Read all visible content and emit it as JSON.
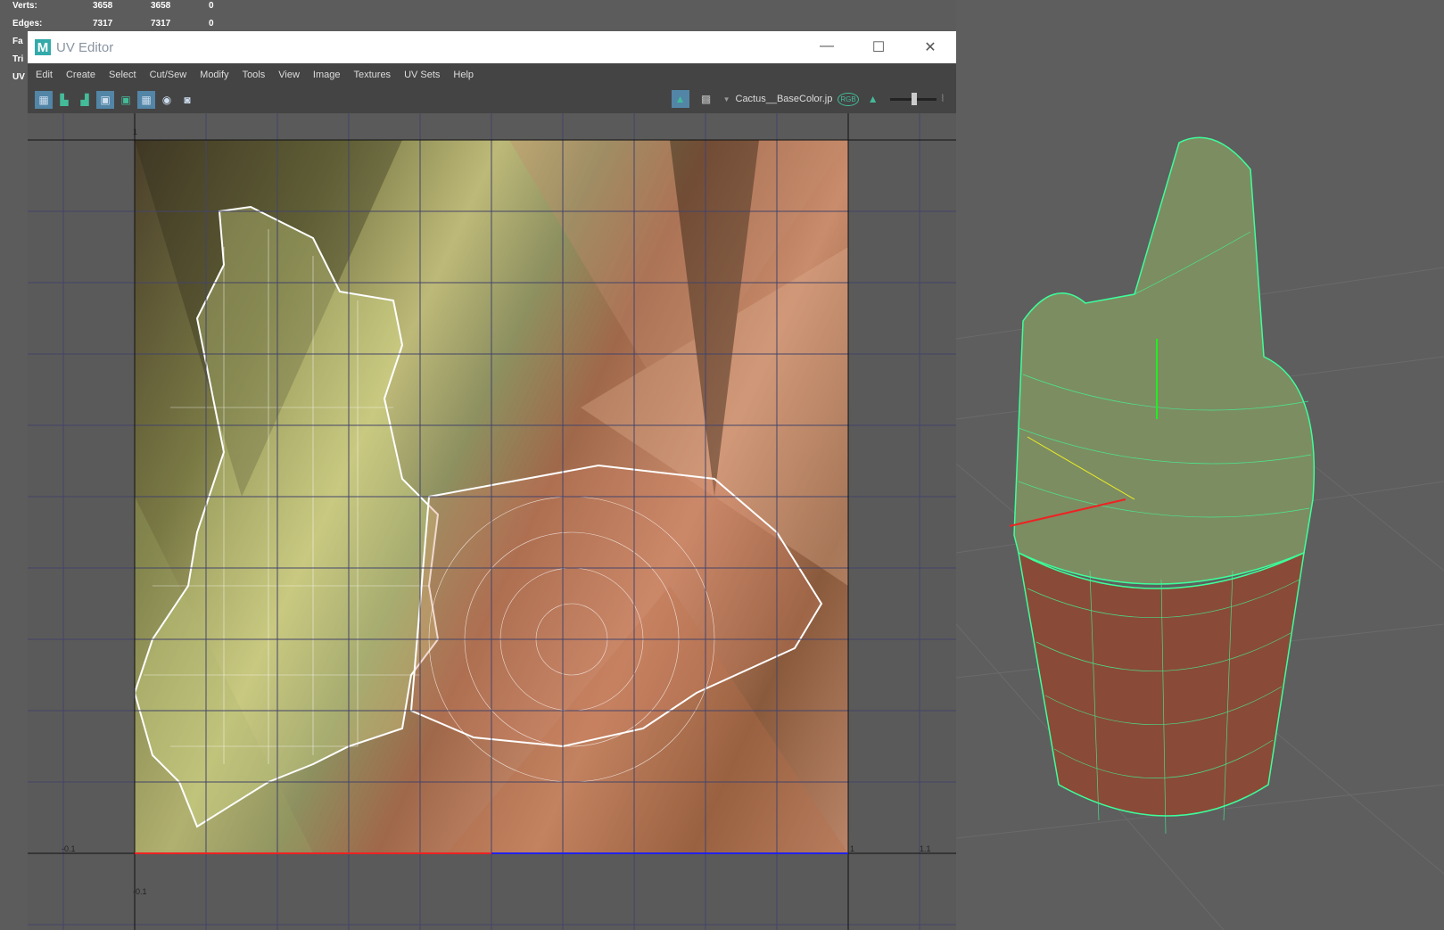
{
  "stats": [
    {
      "label": "Verts:",
      "a": "3658",
      "b": "3658",
      "c": "0"
    },
    {
      "label": "Edges:",
      "a": "7317",
      "b": "7317",
      "c": "0"
    },
    {
      "label": "Fa",
      "a": "",
      "b": "",
      "c": ""
    },
    {
      "label": "Tri",
      "a": "",
      "b": "",
      "c": ""
    },
    {
      "label": "UV",
      "a": "",
      "b": "",
      "c": ""
    }
  ],
  "window": {
    "title": "UV Editor",
    "logo": "M",
    "minimize": "—",
    "maximize": "☐",
    "close": "✕"
  },
  "menu": [
    "Edit",
    "Create",
    "Select",
    "Cut/Sew",
    "Modify",
    "Tools",
    "View",
    "Image",
    "Textures",
    "UV Sets",
    "Help"
  ],
  "toolbar": {
    "texture_name": "Cactus__BaseColor.jp",
    "rgb": "RGB"
  },
  "axis": {
    "top_left": "1",
    "bottom_left": "-0.1",
    "bottom_one": "1",
    "bottom_right": "1.1",
    "lower_left": "-0.1"
  },
  "colors": {
    "wire_uv": "#ffffff",
    "wire_3d": "#3dff9a",
    "accent": "#5285a6"
  }
}
